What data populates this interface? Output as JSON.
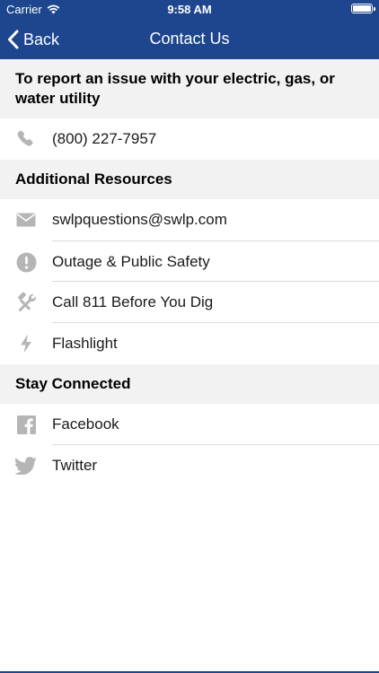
{
  "status_bar": {
    "carrier": "Carrier",
    "time": "9:58 AM"
  },
  "nav": {
    "back_label": "Back",
    "title": "Contact Us"
  },
  "sections": {
    "report": {
      "header": "To report an issue with your electric, gas, or water utility",
      "items": [
        {
          "label": "(800) 227-7957",
          "icon": "phone-icon"
        }
      ]
    },
    "resources": {
      "header": "Additional Resources",
      "items": [
        {
          "label": "swlpquestions@swlp.com",
          "icon": "envelope-icon"
        },
        {
          "label": "Outage & Public Safety",
          "icon": "exclamation-icon"
        },
        {
          "label": "Call 811 Before You Dig",
          "icon": "tools-icon"
        },
        {
          "label": "Flashlight",
          "icon": "lightning-icon"
        }
      ]
    },
    "connected": {
      "header": "Stay Connected",
      "items": [
        {
          "label": "Facebook",
          "icon": "facebook-icon"
        },
        {
          "label": "Twitter",
          "icon": "twitter-icon"
        }
      ]
    }
  },
  "colors": {
    "nav_background": "#1d468f",
    "section_background": "#f2f2f2",
    "icon_gray": "#b5b5b5"
  }
}
